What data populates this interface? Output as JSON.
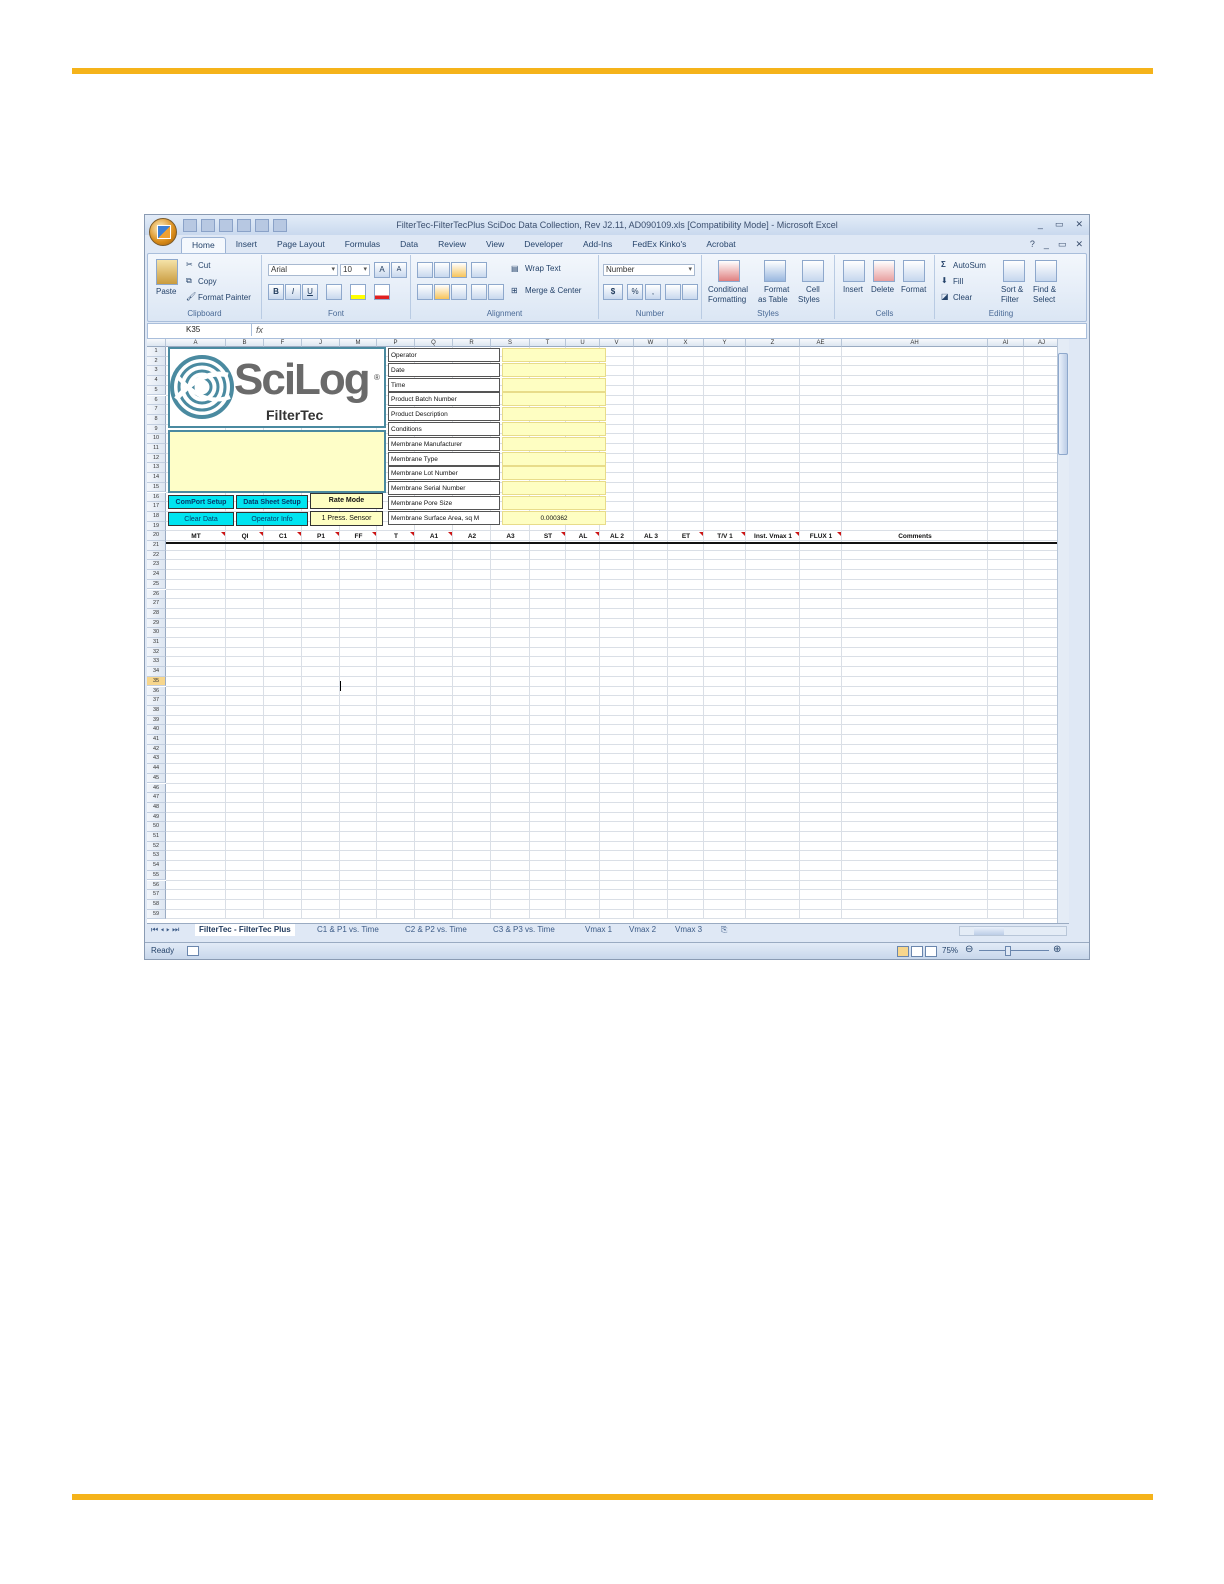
{
  "window": {
    "title": "FilterTec-FilterTecPlus SciDoc Data Collection, Rev J2.11, AD090109.xls  [Compatibility Mode] - Microsoft Excel",
    "controls": [
      "_",
      "▭",
      "✕"
    ]
  },
  "ribbon": {
    "tabs": [
      "Home",
      "Insert",
      "Page Layout",
      "Formulas",
      "Data",
      "Review",
      "View",
      "Developer",
      "Add-Ins",
      "FedEx Kinko's",
      "Acrobat"
    ],
    "clipboard": {
      "label": "Clipboard",
      "paste": "Paste",
      "cut": "Cut",
      "copy": "Copy",
      "format_painter": "Format Painter"
    },
    "font": {
      "label": "Font",
      "name": "Arial",
      "size": "10",
      "bold": "B",
      "italic": "I",
      "underline": "U"
    },
    "alignment": {
      "label": "Alignment",
      "wrap_text": "Wrap Text",
      "merge_center": "Merge & Center"
    },
    "number": {
      "label": "Number",
      "format": "Number",
      "currency": "$",
      "percent": "%",
      "comma": ",",
      "inc": "+.0\n.00",
      "dec": ".00\n+.0"
    },
    "styles": {
      "label": "Styles",
      "conditional_1": "Conditional",
      "conditional_2": "Formatting",
      "format_table_1": "Format",
      "format_table_2": "as Table",
      "cell_styles_1": "Cell",
      "cell_styles_2": "Styles"
    },
    "cells": {
      "label": "Cells",
      "insert": "Insert",
      "delete": "Delete",
      "format": "Format"
    },
    "editing": {
      "label": "Editing",
      "autosum": "AutoSum",
      "fill": "Fill",
      "clear": "Clear",
      "sort_1": "Sort &",
      "sort_2": "Filter",
      "find_1": "Find &",
      "find_2": "Select"
    }
  },
  "formula_bar": {
    "name_box": "K35",
    "fx": "fx",
    "formula": ""
  },
  "columns": [
    {
      "letter": "A",
      "w": 60
    },
    {
      "letter": "B",
      "w": 38
    },
    {
      "letter": "F",
      "w": 38
    },
    {
      "letter": "J",
      "w": 38
    },
    {
      "letter": "M",
      "w": 37
    },
    {
      "letter": "P",
      "w": 38
    },
    {
      "letter": "Q",
      "w": 38
    },
    {
      "letter": "R",
      "w": 38
    },
    {
      "letter": "S",
      "w": 39
    },
    {
      "letter": "T",
      "w": 36
    },
    {
      "letter": "U",
      "w": 34
    },
    {
      "letter": "V",
      "w": 34
    },
    {
      "letter": "W",
      "w": 34
    },
    {
      "letter": "X",
      "w": 36
    },
    {
      "letter": "Y",
      "w": 42
    },
    {
      "letter": "Z",
      "w": 54
    },
    {
      "letter": "AE",
      "w": 42
    },
    {
      "letter": "AH",
      "w": 146
    },
    {
      "letter": "AI",
      "w": 36
    },
    {
      "letter": "AJ",
      "w": 36
    }
  ],
  "logo": {
    "brand": "SciLog",
    "registered": "®",
    "product": "FilterTec"
  },
  "info_labels": [
    "Operator",
    "Date",
    "Time",
    "Product Batch Number",
    "Product Description",
    "Conditions",
    "Membrane Manufacturer",
    "Membrane Type",
    "Membrane Lot Number",
    "Membrane Serial Number",
    "Membrane Pore Size",
    "Membrane Surface Area, sq M"
  ],
  "info_values": [
    "",
    "",
    "",
    "",
    "",
    "",
    "",
    "",
    "",
    "",
    "",
    "0.000362"
  ],
  "macro_buttons": {
    "comport_setup": "ComPort Setup",
    "datasheet_setup": "Data Sheet Setup",
    "rate_mode": "Rate Mode",
    "clear_data": "Clear Data",
    "operator_info": "Operator Info",
    "press_sensor": "1 Press. Sensor"
  },
  "data_headers": [
    "MT",
    "QI",
    "C1",
    "P1",
    "FF",
    "T",
    "A1",
    "A2",
    "A3",
    "ST",
    "AL",
    "AL 2",
    "AL 3",
    "ET",
    "T/V 1",
    "Inst. Vmax 1",
    "FLUX 1",
    "Comments"
  ],
  "active_cell": {
    "row": "35"
  },
  "sheet_tabs": [
    "FilterTec - FilterTec Plus",
    "C1 & P1 vs. Time",
    "C2 & P2 vs. Time",
    "C3 & P3 vs. Time",
    "Vmax 1",
    "Vmax 2",
    "Vmax 3"
  ],
  "status": {
    "ready": "Ready",
    "zoom": "75%"
  },
  "colors": {
    "accent_rule": "#F5B31A",
    "yellow_input": "#FEFEC2",
    "cyan_button": "#00E4F0",
    "logo_border": "#4A8AA0"
  }
}
